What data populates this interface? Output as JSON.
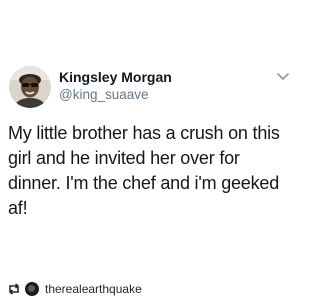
{
  "tweet": {
    "author_name": "Kingsley Morgan",
    "author_handle": "@king_suaave",
    "text": "My little brother has a crush on this girl and he invited her over for dinner. I'm the chef and i'm geeked af!"
  },
  "repost": {
    "username": "therealearthquake"
  },
  "icons": {
    "avatar": "profile-photo",
    "menu": "chevron-down-icon",
    "repost": "repost-icon"
  },
  "colors": {
    "name": "#14171a",
    "handle": "#657786",
    "text": "#14171a",
    "background": "#ffffff"
  }
}
